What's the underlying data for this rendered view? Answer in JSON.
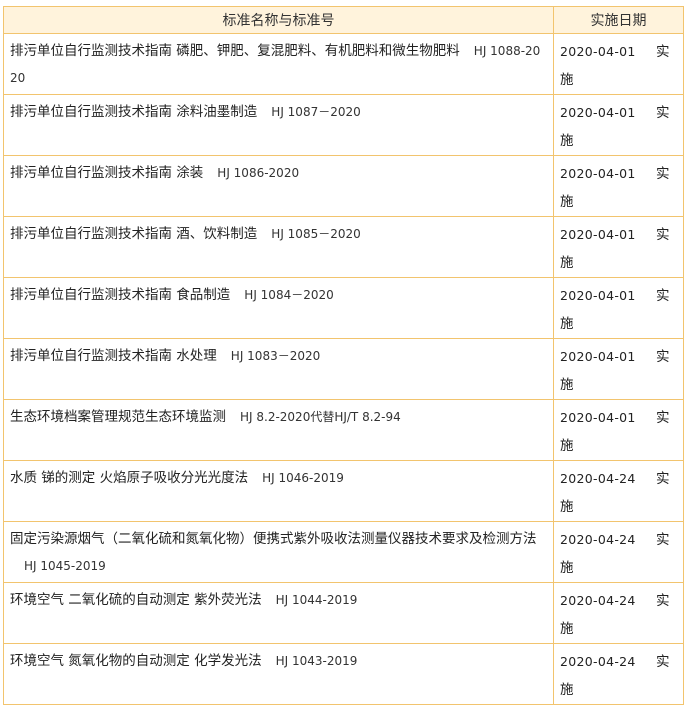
{
  "table": {
    "headers": {
      "name": "标准名称与标准号",
      "date": "实施日期"
    },
    "rows": [
      {
        "name": "排污单位自行监测技术指南  磷肥、钾肥、复混肥料、有机肥料和微生物肥料",
        "number": "HJ 1088-2020",
        "date": "2020-04-01",
        "status": "实施"
      },
      {
        "name": "排污单位自行监测技术指南  涂料油墨制造",
        "number": "HJ 1087－2020",
        "date": "2020-04-01",
        "status": "实施"
      },
      {
        "name": "排污单位自行监测技术指南  涂装",
        "number": "HJ 1086-2020",
        "date": "2020-04-01",
        "status": "实施"
      },
      {
        "name": "排污单位自行监测技术指南  酒、饮料制造",
        "number": "HJ 1085－2020",
        "date": "2020-04-01",
        "status": "实施"
      },
      {
        "name": "排污单位自行监测技术指南  食品制造",
        "number": "HJ 1084－2020",
        "date": "2020-04-01",
        "status": "实施"
      },
      {
        "name": "排污单位自行监测技术指南  水处理",
        "number": "HJ 1083－2020",
        "date": "2020-04-01",
        "status": "实施"
      },
      {
        "name": "生态环境档案管理规范生态环境监测",
        "number": "HJ 8.2-2020代替HJ/T 8.2-94",
        "date": "2020-04-01",
        "status": "实施"
      },
      {
        "name": "水质  锑的测定  火焰原子吸收分光光度法",
        "number": "HJ 1046-2019",
        "date": "2020-04-24",
        "status": "实施"
      },
      {
        "name": "固定污染源烟气（二氧化硫和氮氧化物）便携式紫外吸收法测量仪器技术要求及检测方法",
        "number": "HJ 1045-2019",
        "date": "2020-04-24",
        "status": "实施"
      },
      {
        "name": "环境空气  二氧化硫的自动测定  紫外荧光法",
        "number": "HJ 1044-2019",
        "date": "2020-04-24",
        "status": "实施"
      },
      {
        "name": "环境空气  氮氧化物的自动测定  化学发光法",
        "number": "HJ 1043-2019",
        "date": "2020-04-24",
        "status": "实施"
      }
    ]
  }
}
